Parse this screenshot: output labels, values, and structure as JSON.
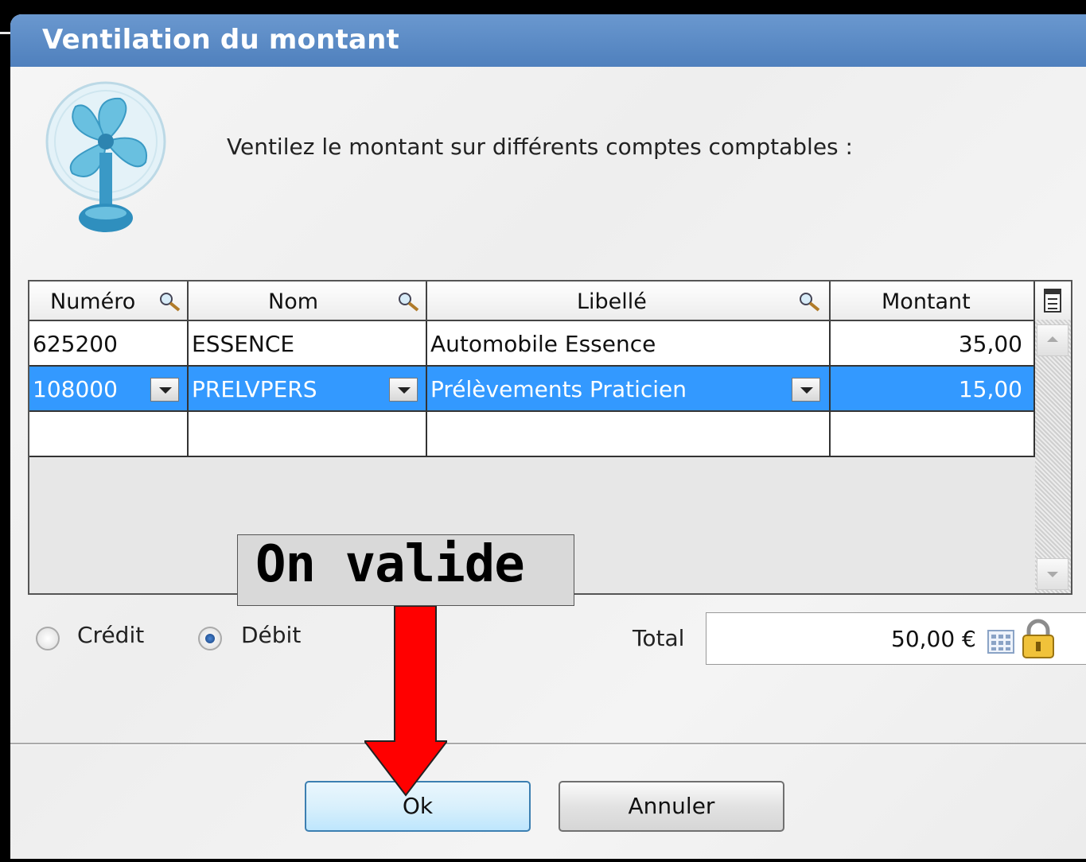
{
  "dialog": {
    "title": "Ventilation du montant",
    "instruction": "Ventilez le montant sur différents comptes comptables :"
  },
  "table": {
    "columns": [
      "Numéro",
      "Nom",
      "Libellé",
      "Montant"
    ],
    "rows": [
      {
        "numero": "625200",
        "nom": "ESSENCE",
        "libelle": "Automobile Essence",
        "montant": "35,00"
      },
      {
        "numero": "108000",
        "nom": "PRELVPERS",
        "libelle": "Prélèvements Praticien",
        "montant": "15,00"
      },
      {
        "numero": "",
        "nom": "",
        "libelle": "",
        "montant": ""
      }
    ],
    "selected_row": 1
  },
  "options": {
    "credit_label": "Crédit",
    "debit_label": "Débit",
    "selected": "Débit"
  },
  "total": {
    "label": "Total",
    "value": "50,00 €"
  },
  "buttons": {
    "ok": "Ok",
    "cancel": "Annuler"
  },
  "annotation": {
    "text": "On valide"
  },
  "colors": {
    "titlebar": "#5a8bc6",
    "selection": "#3399ff",
    "arrow": "#ff0000"
  },
  "icons": [
    "fan-icon",
    "magnifier-icon",
    "column-chooser-icon",
    "dropdown-icon",
    "calculator-icon",
    "lock-icon"
  ]
}
